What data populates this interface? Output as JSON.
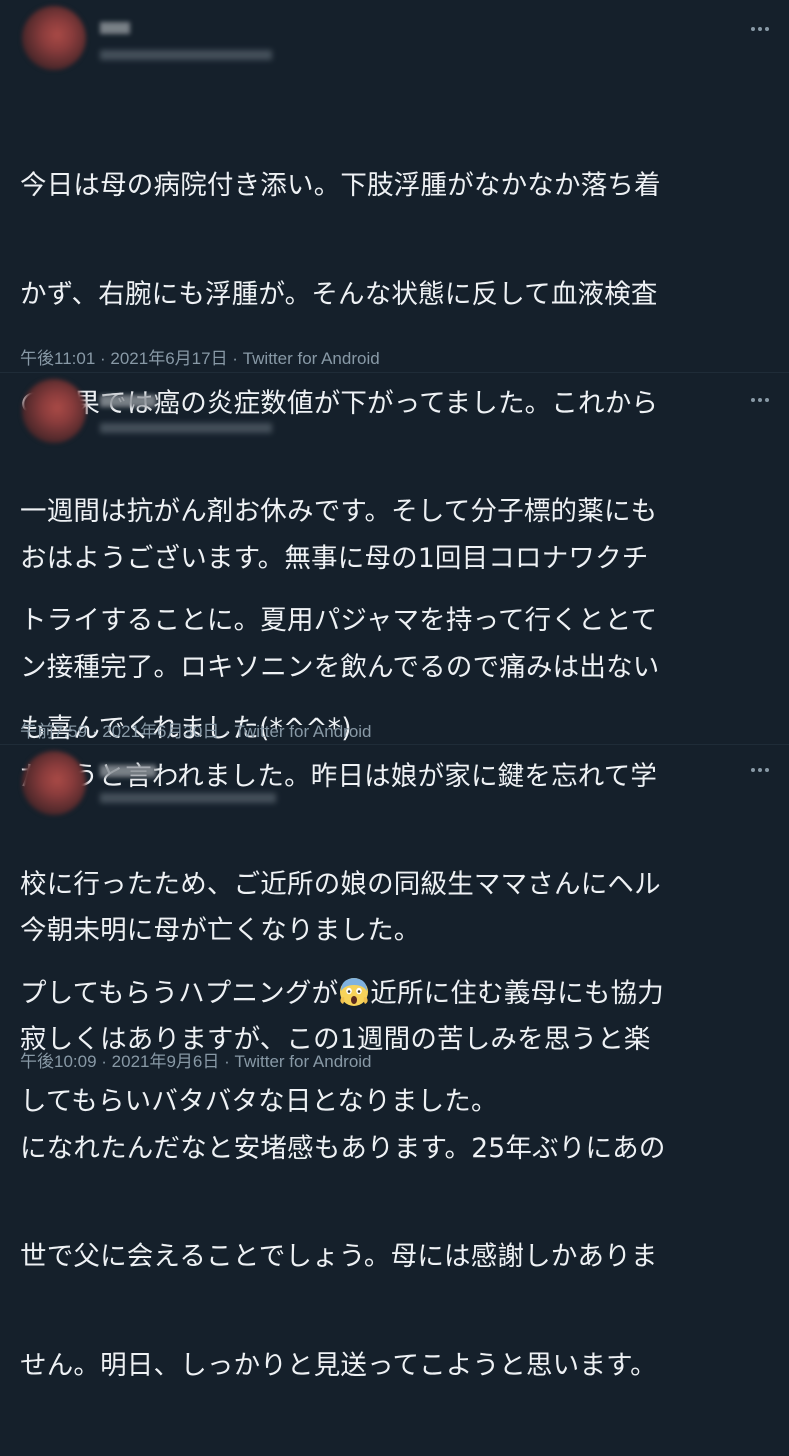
{
  "tweets": [
    {
      "line1": "今日は母の病院付き添い。下肢浮腫がなかなか落ち着",
      "line2": "かず、右腕にも浮腫が。そんな状態に反して血液検査",
      "line3": "の結果では癌の炎症数値が下がってました。これから",
      "line4": "一週間は抗がん剤お休みです。そして分子標的薬にも",
      "line5": "トライすることに。夏用パジャマを持って行くととて",
      "line6": "も喜んでくれました(*^^*)",
      "time": "午後11:01",
      "date": "2021年6月17日",
      "client": "Twitter for Android"
    },
    {
      "line1": "おはようございます。無事に母の1回目コロナワクチ",
      "line2": "ン接種完了。ロキソニンを飲んでるので痛みは出ない",
      "line3": "だろうと言われました。昨日は娘が家に鍵を忘れて学",
      "line4": "校に行ったため、ご近所の娘の同級生ママさんにヘル",
      "line5a": "プしてもらうハプニングが",
      "line5b": "近所に住む義母にも協力",
      "line6": "してもらいバタバタな日となりました。",
      "time": "午前7:59",
      "date": "2021年6月30日",
      "client": "Twitter for Android"
    },
    {
      "line1": "今朝未明に母が亡くなりました。",
      "line2": "寂しくはありますが、この1週間の苦しみを思うと楽",
      "line3": "になれたんだなと安堵感もあります。25年ぶりにあの",
      "line4": "世で父に会えることでしょう。母には感謝しかありま",
      "line5": "せん。明日、しっかりと見送ってこようと思います。",
      "time": "午後10:09",
      "date": "2021年9月6日",
      "client": "Twitter for Android"
    }
  ],
  "separator": " · ",
  "icons": {
    "more": "more-icon",
    "emoji": "face-screaming-in-fear-emoji"
  },
  "colors": {
    "background": "#15202b",
    "text": "#eef1f4",
    "meta": "#8899a6"
  }
}
